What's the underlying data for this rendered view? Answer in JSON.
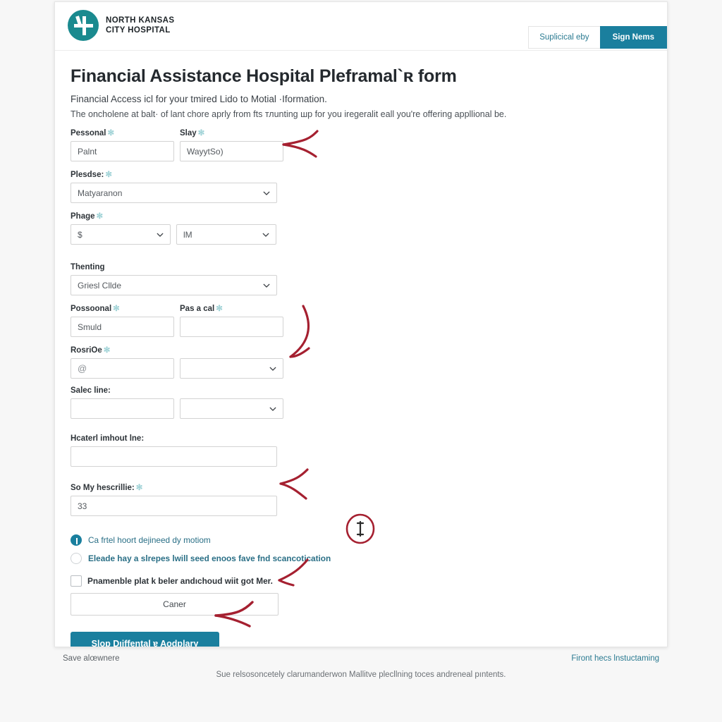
{
  "brand": {
    "line1": "NORTH KANSAS",
    "line2": "CITY HOSPITAL",
    "logo_icon": "hospital-cross-logo-icon",
    "logo_color": "#1a8a8f"
  },
  "header": {
    "secondary_button": "Suplicical eby",
    "primary_button": "Sign Nems",
    "primary_color": "#1a7f9e"
  },
  "main": {
    "title": "Financial Assistance Hospital Pleframal`ʀ form",
    "lede": "Financial Access icl for your tmired Lido to Motial ·Iformation.",
    "lede2": "The oncholene at balt· of lant chore aprly from fts тлunting шp for you iregeralit eall you're offering appllional be."
  },
  "form": {
    "required_marker": "✻",
    "fields": [
      {
        "label": "Pessonal",
        "required": true,
        "type": "text",
        "value": "Palnt"
      },
      {
        "label": "Slay",
        "required": true,
        "type": "text",
        "value": "WayytSo)"
      },
      {
        "label": "Plesdse:",
        "required": true,
        "type": "select",
        "value": "Matyaranon"
      },
      {
        "label": "Phage",
        "required": true,
        "type": "select",
        "value": "$"
      },
      {
        "label": "",
        "required": false,
        "type": "select",
        "value": "ƖM"
      },
      {
        "label": "Thenting",
        "required": false,
        "type": "select",
        "value": "Griesl Cllde"
      },
      {
        "label": "Possoonal",
        "required": true,
        "type": "text",
        "value": "Smuld"
      },
      {
        "label": "Pas a cal",
        "required": true,
        "type": "text",
        "value": ""
      },
      {
        "label": "RosriOe",
        "required": true,
        "type": "text",
        "value": "@"
      },
      {
        "label": "",
        "required": false,
        "type": "select",
        "value": ""
      },
      {
        "label": "Salec line:",
        "required": false,
        "type": "text",
        "value": ""
      },
      {
        "label": "",
        "required": false,
        "type": "select",
        "value": ""
      },
      {
        "label": "Hcaterl imhout lne:",
        "required": false,
        "type": "text",
        "value": ""
      },
      {
        "label": "So My hescrillie:",
        "required": true,
        "type": "text",
        "value": "33"
      }
    ],
    "choices": [
      {
        "label": "Ca frtel hoort dejineed dy motiom",
        "selected": true,
        "bold": false
      },
      {
        "label": "Eleade hay a slrepes lwill seed enoos fave fnd scancotication",
        "selected": false,
        "bold": true
      }
    ],
    "checkbox": {
      "label": "Pnamenble plat k beler andıchoud wiit got Mer.",
      "checked": false
    },
    "cancel_button": "Caner",
    "submit_button": "Slop Dıiffental ɐ Aodplary"
  },
  "footer": {
    "left": "Save alœwnere",
    "right": "Firont hecs lnstuctaming",
    "note": "Sue relsosoncetely clarumanderwon Mallitve plecllning toces andreneal pıntents."
  },
  "annotations": {
    "color": "#a52030",
    "items": [
      {
        "name": "arrow-to-slay-field"
      },
      {
        "name": "arrow-to-rosrioe-dropdown"
      },
      {
        "name": "arrow-to-so-my-hescrillie-field"
      },
      {
        "name": "circle-on-choice-row"
      },
      {
        "name": "arrow-to-cancel-button"
      },
      {
        "name": "arrow-to-submit-button"
      }
    ]
  }
}
